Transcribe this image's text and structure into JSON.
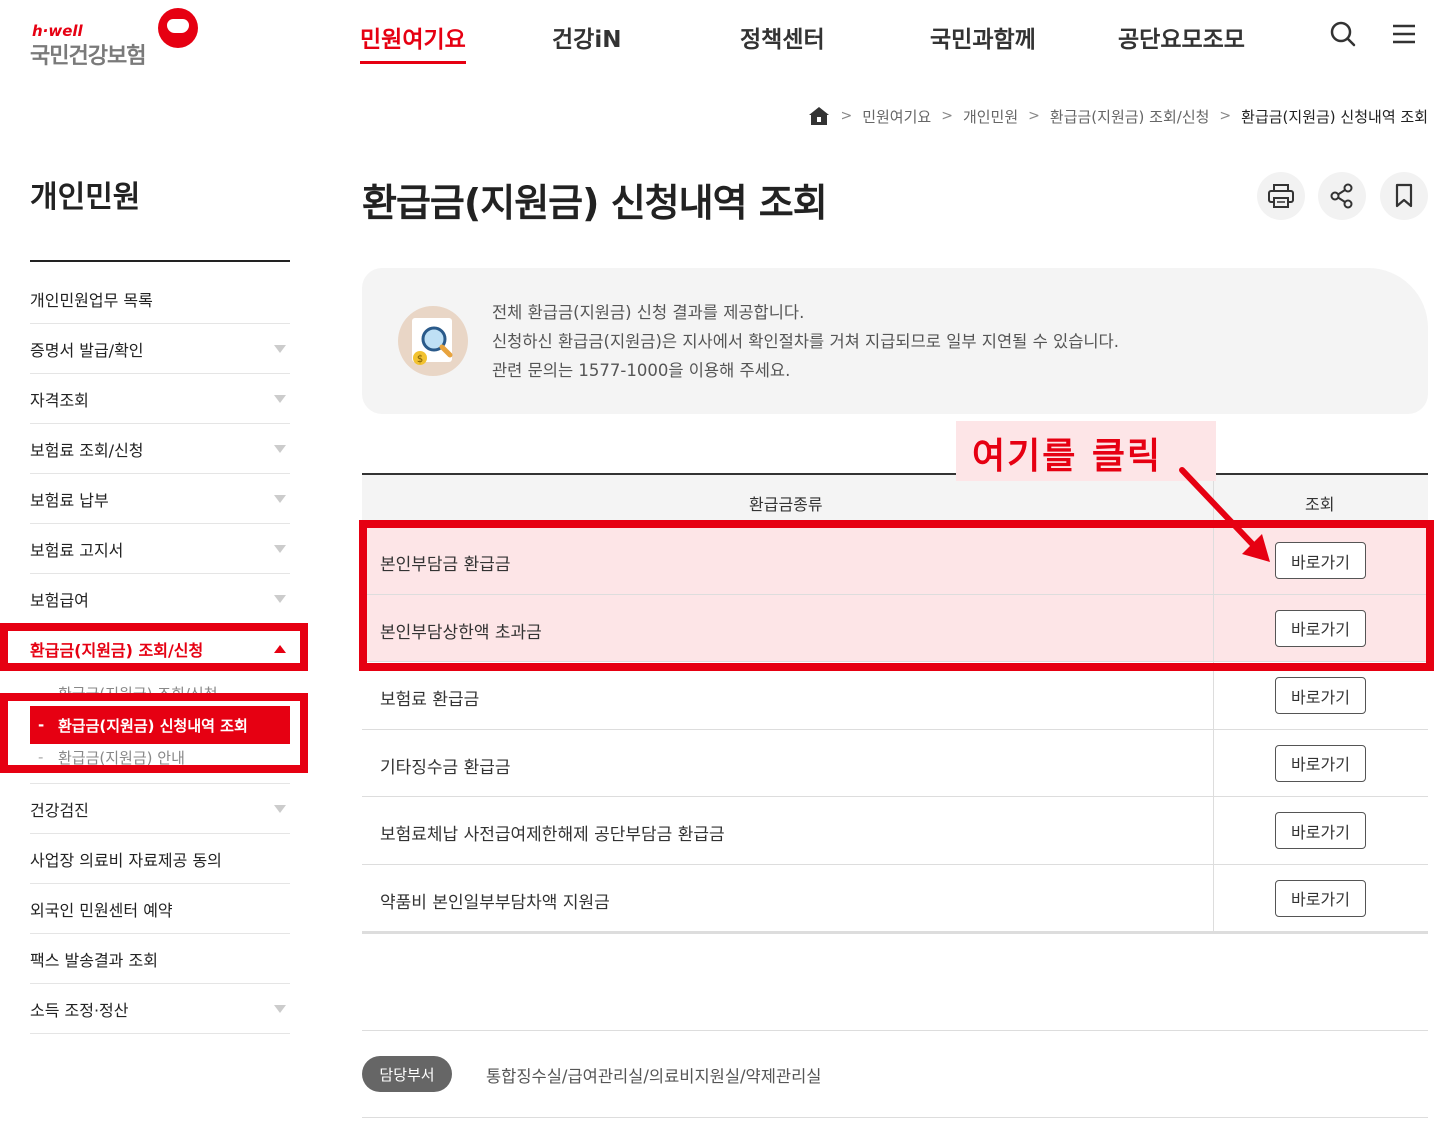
{
  "header": {
    "logo_small": "h·well",
    "logo_main": "국민건강보험",
    "nav": [
      {
        "label": "민원여기요",
        "active": true
      },
      {
        "label": "건강iN",
        "active": false
      },
      {
        "label": "정책센터",
        "active": false
      },
      {
        "label": "국민과함께",
        "active": false
      },
      {
        "label": "공단요모조모",
        "active": false
      }
    ],
    "icons": [
      "search-icon",
      "menu-icon"
    ],
    "accent_color": "#e60012"
  },
  "breadcrumb": {
    "home_icon": "home-icon",
    "items": [
      "민원여기요",
      "개인민원",
      "환급금(지원금) 조회/신청",
      "환급금(지원금) 신청내역 조회"
    ]
  },
  "sidebar": {
    "title": "개인민원",
    "items": [
      {
        "label": "개인민원업무 목록",
        "has_arrow": false
      },
      {
        "label": "증명서 발급/확인",
        "has_arrow": true
      },
      {
        "label": "자격조회",
        "has_arrow": true
      },
      {
        "label": "보험료 조회/신청",
        "has_arrow": true
      },
      {
        "label": "보험료 납부",
        "has_arrow": true
      },
      {
        "label": "보험료 고지서",
        "has_arrow": true
      },
      {
        "label": "보험급여",
        "has_arrow": true
      },
      {
        "label": "환급금(지원금) 조회/신청",
        "has_arrow": true,
        "open": true
      }
    ],
    "sub_items": [
      {
        "label": "환급금(지원금) 조회/신청",
        "active": false
      },
      {
        "label": "환급금(지원금) 신청내역 조회",
        "active": true
      },
      {
        "label": "환급금(지원금) 안내",
        "active": false
      }
    ],
    "items_after": [
      {
        "label": "건강검진",
        "has_arrow": true
      },
      {
        "label": "사업장 의료비 자료제공 동의",
        "has_arrow": false
      },
      {
        "label": "외국인 민원센터 예약",
        "has_arrow": false
      },
      {
        "label": "팩스 발송결과 조회",
        "has_arrow": false
      },
      {
        "label": "소득 조정·정산",
        "has_arrow": true
      }
    ]
  },
  "main": {
    "title": "환급금(지원금) 신청내역 조회",
    "util_icons": [
      "print-icon",
      "share-icon",
      "bookmark-icon"
    ],
    "info_icon": "magnifier-coin-icon",
    "info_lines": [
      "전체 환급금(지원금) 신청 결과를 제공합니다.",
      "신청하신 환급금(지원금)은 지사에서 확인절차를 거쳐 지급되므로 일부 지연될 수 있습니다.",
      "관련 문의는 1577-1000을 이용해 주세요."
    ],
    "callout": "여기를 클릭",
    "table": {
      "headers": [
        "환급금종류",
        "조회"
      ],
      "rows": [
        {
          "name": "본인부담금 환급금",
          "button": "바로가기",
          "highlighted": true
        },
        {
          "name": "본인부담상한액 초과금",
          "button": "바로가기",
          "highlighted": true
        },
        {
          "name": "보험료 환급금",
          "button": "바로가기",
          "highlighted": false
        },
        {
          "name": "기타징수금 환급금",
          "button": "바로가기",
          "highlighted": false
        },
        {
          "name": "보험료체납 사전급여제한해제 공단부담금 환급금",
          "button": "바로가기",
          "highlighted": false
        },
        {
          "name": "약품비 본인일부부담차액 지원금",
          "button": "바로가기",
          "highlighted": false
        }
      ]
    },
    "department": {
      "label": "담당부서",
      "value": "통합징수실/급여관리실/의료비지원실/약제관리실"
    }
  }
}
